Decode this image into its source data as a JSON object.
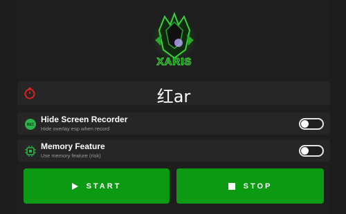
{
  "timer": {
    "text": "红ar",
    "icon": "stopwatch-icon"
  },
  "options": [
    {
      "icon": "rec-icon",
      "title": "Hide Screen Recorder",
      "subtitle": "Hide overlay esp when record",
      "enabled": false,
      "icon_text": "REC"
    },
    {
      "icon": "chip-icon",
      "title": "Memory Feature",
      "subtitle": "Use memory feature (risk)",
      "enabled": false
    }
  ],
  "buttons": {
    "start": "START",
    "stop": "STOP"
  },
  "logo": {
    "text": "XARIS",
    "icon": "logo-emblem"
  },
  "colors": {
    "accent": "#0c9a12",
    "icon_red": "#e02020",
    "icon_green": "#2db34a",
    "panel": "#262626",
    "background": "#1c1c1c"
  }
}
